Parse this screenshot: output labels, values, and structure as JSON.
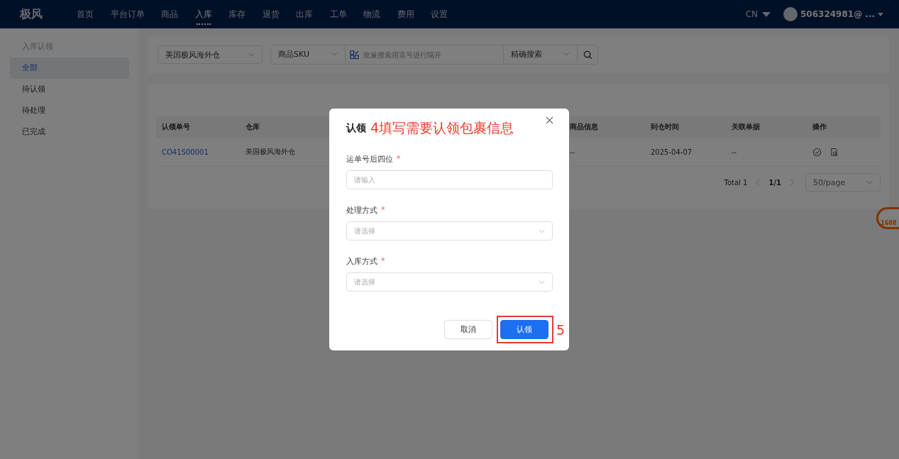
{
  "topbar": {
    "logo": "极风",
    "nav": [
      {
        "label": "首页",
        "selected": false
      },
      {
        "label": "平台订单",
        "selected": false
      },
      {
        "label": "商品",
        "selected": false
      },
      {
        "label": "入库",
        "selected": true
      },
      {
        "label": "库存",
        "selected": false
      },
      {
        "label": "退货",
        "selected": false
      },
      {
        "label": "出库",
        "selected": false
      },
      {
        "label": "工单",
        "selected": false
      },
      {
        "label": "物流",
        "selected": false
      },
      {
        "label": "费用",
        "selected": false
      },
      {
        "label": "设置",
        "selected": false
      }
    ],
    "language": "CN",
    "user": "506324981@ ..."
  },
  "sidebar": {
    "title": "入库认领",
    "items": [
      {
        "label": "全部",
        "selected": true
      },
      {
        "label": "待认领",
        "selected": false
      },
      {
        "label": "待处理",
        "selected": false
      },
      {
        "label": "已完成",
        "selected": false
      }
    ]
  },
  "filters": {
    "warehouse": "美国极风海外仓",
    "field": "商品SKU",
    "search_placeholder": "批量搜索用逗号进行隔开",
    "match": "精确搜索"
  },
  "table": {
    "columns": [
      {
        "label": "认领单号",
        "kind": "link"
      },
      {
        "label": "仓库",
        "kind": "text"
      },
      {
        "label": "商品信息",
        "kind": "text"
      },
      {
        "label": "到仓时间",
        "kind": "text"
      },
      {
        "label": "关联单据",
        "kind": "text"
      },
      {
        "label": "操作",
        "kind": "actions"
      }
    ],
    "rows": [
      [
        "CO41S00001",
        "美国极风海外仓",
        "--",
        "2025-04-07",
        "--"
      ]
    ]
  },
  "pagination": {
    "total": "Total 1",
    "page": "1/1",
    "page_size": "50/page"
  },
  "side_badge": {
    "label": "1688"
  },
  "dialog": {
    "title": "认领",
    "fields": [
      {
        "label": "运单号后四位",
        "required_mark": "*",
        "kind": "input",
        "placeholder": "请输入"
      },
      {
        "label": "处理方式",
        "required_mark": "*",
        "kind": "select",
        "placeholder": "请选择"
      },
      {
        "label": "入库方式",
        "required_mark": "*",
        "kind": "select",
        "placeholder": "请选择"
      }
    ],
    "buttons": [
      {
        "label": "取消",
        "kind": "secondary",
        "highlighted": false
      },
      {
        "label": "认领",
        "kind": "primary",
        "highlighted": true
      }
    ]
  },
  "annotations": {
    "title_note": "4填写需要认领包裹信息",
    "button_note": "5"
  }
}
